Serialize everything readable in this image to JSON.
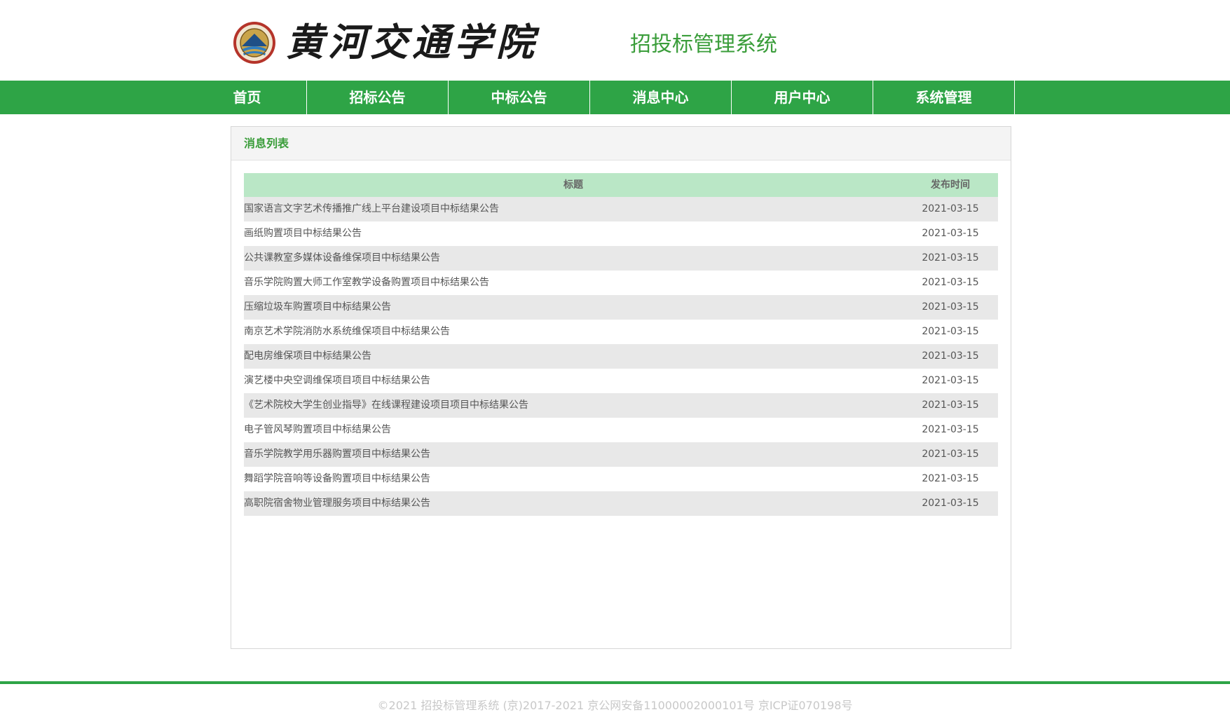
{
  "header": {
    "school_name": "黄河交通学院",
    "system_title": "招投标管理系统",
    "logo_icon": "school-seal-icon"
  },
  "nav": {
    "items": [
      {
        "label": "首页"
      },
      {
        "label": "招标公告"
      },
      {
        "label": "中标公告"
      },
      {
        "label": "消息中心"
      },
      {
        "label": "用户中心"
      },
      {
        "label": "系统管理"
      }
    ]
  },
  "panel": {
    "title": "消息列表",
    "columns": {
      "title": "标题",
      "date": "发布时间"
    },
    "rows": [
      {
        "title": "国家语言文字艺术传播推广线上平台建设项目中标结果公告",
        "date": "2021-03-15"
      },
      {
        "title": "画纸购置项目中标结果公告",
        "date": "2021-03-15"
      },
      {
        "title": "公共课教室多媒体设备维保项目中标结果公告",
        "date": "2021-03-15"
      },
      {
        "title": "音乐学院购置大师工作室教学设备购置项目中标结果公告",
        "date": "2021-03-15"
      },
      {
        "title": "压缩垃圾车购置项目中标结果公告",
        "date": "2021-03-15"
      },
      {
        "title": "南京艺术学院消防水系统维保项目中标结果公告",
        "date": "2021-03-15"
      },
      {
        "title": "配电房维保项目中标结果公告",
        "date": "2021-03-15"
      },
      {
        "title": "演艺楼中央空调维保项目项目中标结果公告",
        "date": "2021-03-15"
      },
      {
        "title": "《艺术院校大学生创业指导》在线课程建设项目项目中标结果公告",
        "date": "2021-03-15"
      },
      {
        "title": "电子管风琴购置项目中标结果公告",
        "date": "2021-03-15"
      },
      {
        "title": "音乐学院教学用乐器购置项目中标结果公告",
        "date": "2021-03-15"
      },
      {
        "title": "舞蹈学院音响等设备购置项目中标结果公告",
        "date": "2021-03-15"
      },
      {
        "title": "高职院宿舍物业管理服务项目中标结果公告",
        "date": "2021-03-15"
      }
    ]
  },
  "footer": {
    "text": "©2021 招投标管理系统 (京)2017-2021 京公网安备11000002000101号 京ICP证070198号"
  },
  "colors": {
    "brand_green": "#2ea446",
    "header_row": "#bae7c6",
    "title_green": "#3a9d3a"
  }
}
